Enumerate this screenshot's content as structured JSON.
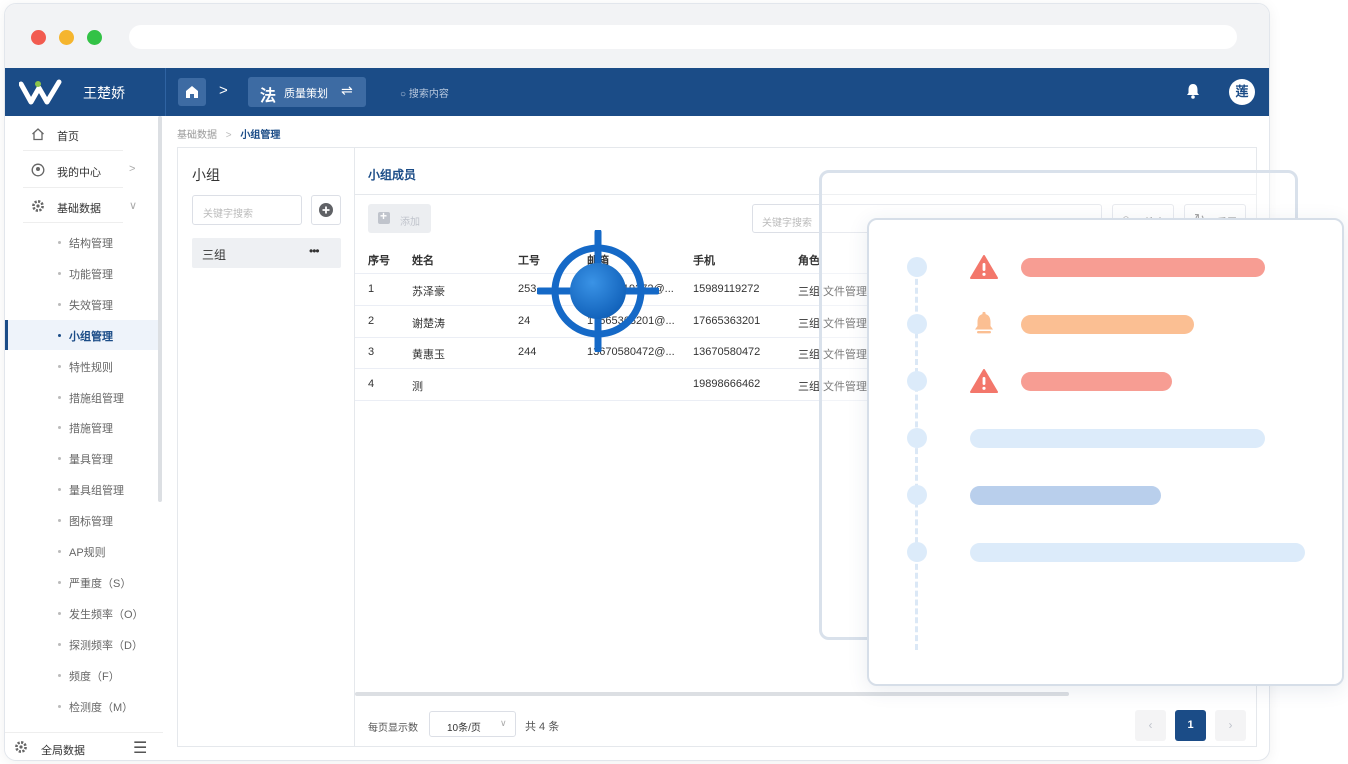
{
  "app": {
    "user_name": "王楚娇",
    "module_char": "法",
    "module_name": "质量策划",
    "search_placeholder": "搜索内容",
    "avatar_char": "莲"
  },
  "sidebar": {
    "top_items": [
      {
        "label": "首页",
        "icon": "home-icon"
      },
      {
        "label": "我的中心",
        "icon": "user-circle-icon"
      },
      {
        "label": "基础数据",
        "icon": "gear-icon"
      }
    ],
    "sub_items": [
      "结构管理",
      "功能管理",
      "失效管理",
      "小组管理",
      "特性规则",
      "措施组管理",
      "措施管理",
      "量具管理",
      "量具组管理",
      "图标管理",
      "AP规则",
      "严重度（S）",
      "发生频率（O）",
      "探测频率（D）",
      "频度（F）",
      "检测度（M）"
    ],
    "active_sub_index": 3,
    "footer_label": "全局数据"
  },
  "breadcrumb": {
    "parent": "基础数据",
    "current": "小组管理"
  },
  "groups": {
    "title": "小组",
    "search_placeholder": "关键字搜索",
    "items": [
      "三组"
    ]
  },
  "members": {
    "title": "小组成员",
    "add_label": "添加",
    "search_placeholder": "关键字搜索",
    "search_button": "搜索",
    "reset_button": "重置",
    "columns": [
      "序号",
      "姓名",
      "工号",
      "邮箱",
      "手机",
      "角色"
    ],
    "rows": [
      {
        "no": "1",
        "name": "苏泽豪",
        "id": "253",
        "email": "15989119272@...",
        "phone": "15989119272",
        "role": "三组,文件管理员"
      },
      {
        "no": "2",
        "name": "谢楚涛",
        "id": "24",
        "email": "17665363201@...",
        "phone": "17665363201",
        "role": "三组,文件管理员"
      },
      {
        "no": "3",
        "name": "黄惠玉",
        "id": "244",
        "email": "13670580472@...",
        "phone": "13670580472",
        "role": "三组,文件管理员"
      },
      {
        "no": "4",
        "name": "测",
        "id": "",
        "email": "",
        "phone": "19898666462",
        "role": "三组,文件管理员"
      }
    ]
  },
  "pagination": {
    "per_page_label": "每页显示数",
    "per_page_value": "10条/页",
    "total": "共 4 条",
    "prev": "‹",
    "current_page": "1",
    "next": "›"
  },
  "overlay": {
    "colors": {
      "danger": "#f79d93",
      "warning": "#fbbf93",
      "light_blue": "#dcebfa",
      "mid_blue": "#b9cfec"
    },
    "events": [
      {
        "icon": "warning-triangle-icon",
        "bar_fraction": 0.86,
        "color": "#f79d93"
      },
      {
        "icon": "bell-icon",
        "bar_fraction": 0.61,
        "color": "#fbbf93"
      },
      {
        "icon": "warning-triangle-icon",
        "bar_fraction": 0.53,
        "color": "#f79d93"
      },
      {
        "icon": "",
        "bar_fraction": 0.88,
        "color": "#dcebfa"
      },
      {
        "icon": "",
        "bar_fraction": 0.57,
        "color": "#b9cfec"
      },
      {
        "icon": "",
        "bar_fraction": 1.0,
        "color": "#dcebfa"
      }
    ]
  }
}
